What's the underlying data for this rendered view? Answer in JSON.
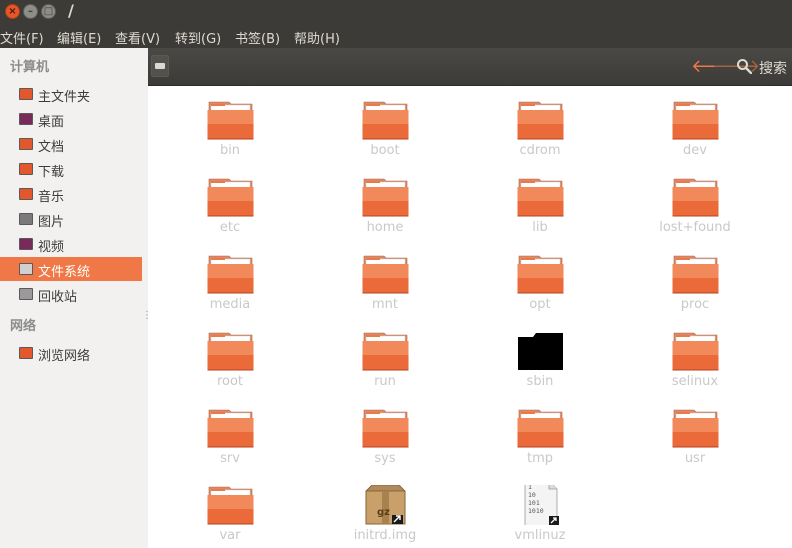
{
  "window": {
    "title": "/",
    "close_glyph": "×",
    "minimize_glyph": "–",
    "maximize_glyph": "□"
  },
  "menu": [
    {
      "label": "文件(F)"
    },
    {
      "label": "编辑(E)"
    },
    {
      "label": "查看(V)"
    },
    {
      "label": "转到(G)"
    },
    {
      "label": "书签(B)"
    },
    {
      "label": "帮助(H)"
    }
  ],
  "sidebar": {
    "computer_heading": "计算机",
    "network_heading": "网络",
    "grip": "⋮",
    "places": [
      {
        "label": "主文件夹",
        "icon": "home-folder-icon",
        "color": "#e2582c"
      },
      {
        "label": "桌面",
        "icon": "desktop-icon",
        "color": "#7a2a5a"
      },
      {
        "label": "文档",
        "icon": "documents-icon",
        "color": "#e2582c"
      },
      {
        "label": "下载",
        "icon": "downloads-icon",
        "color": "#e2582c"
      },
      {
        "label": "音乐",
        "icon": "music-icon",
        "color": "#e2582c"
      },
      {
        "label": "图片",
        "icon": "pictures-icon",
        "color": "#7a7a7a"
      },
      {
        "label": "视频",
        "icon": "videos-icon",
        "color": "#7a2a5a"
      },
      {
        "label": "文件系统",
        "icon": "filesystem-icon",
        "color": "#d0d0d0",
        "active": true
      },
      {
        "label": "回收站",
        "icon": "trash-icon",
        "color": "#9a9a9a"
      }
    ],
    "network": [
      {
        "label": "浏览网络",
        "icon": "network-icon",
        "color": "#e2582c"
      }
    ]
  },
  "toolbar": {
    "back_glyph": "🡐",
    "forward_glyph": "🡒",
    "search_label": "搜索"
  },
  "files": [
    {
      "name": "bin",
      "type": "folder"
    },
    {
      "name": "boot",
      "type": "folder"
    },
    {
      "name": "cdrom",
      "type": "folder"
    },
    {
      "name": "dev",
      "type": "folder"
    },
    {
      "name": "etc",
      "type": "folder"
    },
    {
      "name": "home",
      "type": "folder"
    },
    {
      "name": "lib",
      "type": "folder"
    },
    {
      "name": "lost+found",
      "type": "folder"
    },
    {
      "name": "media",
      "type": "folder"
    },
    {
      "name": "mnt",
      "type": "folder"
    },
    {
      "name": "opt",
      "type": "folder"
    },
    {
      "name": "proc",
      "type": "folder"
    },
    {
      "name": "root",
      "type": "folder"
    },
    {
      "name": "run",
      "type": "folder"
    },
    {
      "name": "sbin",
      "type": "folder-black"
    },
    {
      "name": "selinux",
      "type": "folder"
    },
    {
      "name": "srv",
      "type": "folder"
    },
    {
      "name": "sys",
      "type": "folder"
    },
    {
      "name": "tmp",
      "type": "folder"
    },
    {
      "name": "usr",
      "type": "folder"
    },
    {
      "name": "var",
      "type": "folder"
    },
    {
      "name": "initrd.img",
      "type": "archive-link",
      "badge": "gz"
    },
    {
      "name": "vmlinuz",
      "type": "binary-link",
      "lines": [
        "1",
        "10",
        "101",
        "1010"
      ]
    }
  ],
  "colors": {
    "accent": "#f07746",
    "folder_top": "#f59a6a",
    "folder_bottom": "#e2582c",
    "titlebar": "#3c3b37"
  }
}
